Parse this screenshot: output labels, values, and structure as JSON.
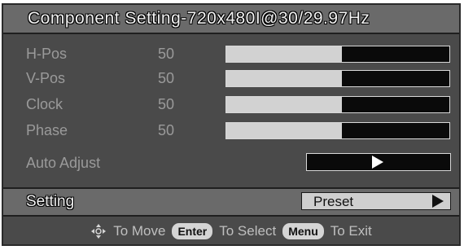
{
  "title": "Component Setting-720x480I@30/29.97Hz",
  "rows": [
    {
      "label": "H-Pos",
      "value": "50",
      "level": 0.52
    },
    {
      "label": "V-Pos",
      "value": "50",
      "level": 0.52
    },
    {
      "label": "Clock",
      "value": "50",
      "level": 0.52
    },
    {
      "label": "Phase",
      "value": "50",
      "level": 0.52
    }
  ],
  "auto_adjust": {
    "label": "Auto Adjust"
  },
  "setting": {
    "label": "Setting",
    "value": "Preset"
  },
  "help": {
    "move": "To Move",
    "enter_key": "Enter",
    "select": "To Select",
    "menu_key": "Menu",
    "exit": "To Exit"
  },
  "icons": [
    "move-icon",
    "arrow-right-icon"
  ],
  "colors": {
    "panel": "#4a4a4a",
    "bar": "#6a6a6a",
    "slider_fill": "#d2d2d2"
  }
}
